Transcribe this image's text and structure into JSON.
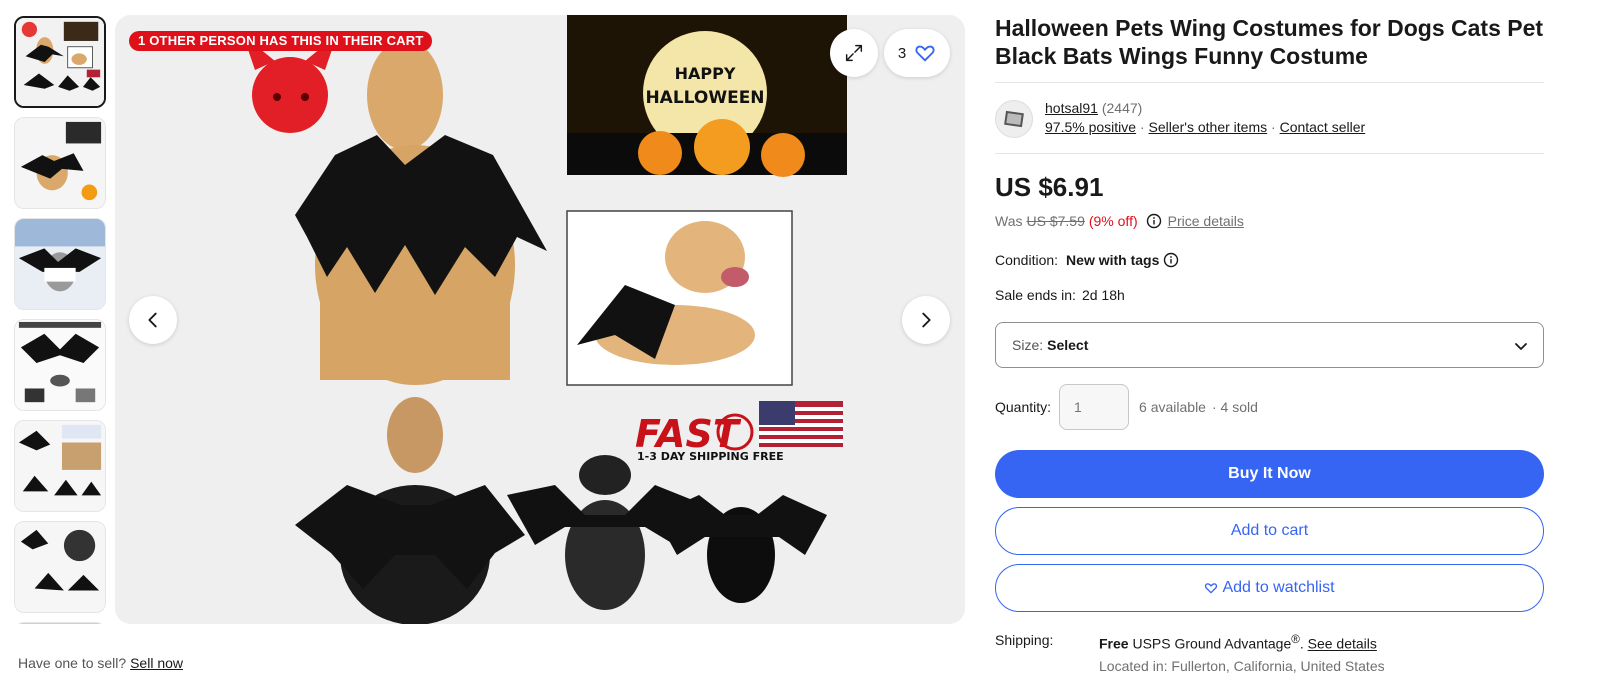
{
  "gallery": {
    "cart_badge": "1 OTHER PERSON HAS THIS IN THEIR CART",
    "watch_count": "3",
    "thumbnails": [
      {
        "name": "thumbnail-1",
        "active": true
      },
      {
        "name": "thumbnail-2",
        "active": false
      },
      {
        "name": "thumbnail-3",
        "active": false
      },
      {
        "name": "thumbnail-4",
        "active": false
      },
      {
        "name": "thumbnail-5",
        "active": false
      },
      {
        "name": "thumbnail-6",
        "active": false
      },
      {
        "name": "thumbnail-7",
        "active": false
      }
    ],
    "image_text": {
      "happy": "HAPPY",
      "halloween": "HALLOWEEN",
      "fast": "FAST",
      "shipping": "1-3 DAY SHIPPING FREE"
    }
  },
  "sell": {
    "prompt": "Have one to sell?",
    "link": "Sell now"
  },
  "product": {
    "title": "Halloween Pets Wing Costumes for Dogs Cats Pet Black Bats Wings Funny Costume",
    "seller": {
      "name": "hotsal91",
      "feedback_count": "(2447)",
      "positive": "97.5% positive",
      "other_items": "Seller's other items",
      "contact": "Contact seller"
    },
    "price": "US $6.91",
    "was_label": "Was",
    "was_price": "US $7.59",
    "discount": "(9% off)",
    "price_details": "Price details",
    "condition_label": "Condition:",
    "condition_value": "New with tags",
    "sale_label": "Sale ends in:",
    "sale_value": "2d 18h",
    "size_label": "Size:",
    "size_value": "Select",
    "quantity_label": "Quantity:",
    "quantity_placeholder": "1",
    "available": "6 available",
    "sold": "· 4 sold",
    "buy_now": "Buy It Now",
    "add_to_cart": "Add to cart",
    "add_to_watchlist": "Add to watchlist",
    "shipping_label": "Shipping:",
    "shipping_free": "Free",
    "shipping_method": "USPS Ground Advantage",
    "shipping_reg": "®",
    "shipping_see": "See details",
    "shipping_location": "Located in: Fullerton, California, United States"
  },
  "colors": {
    "accent_blue": "#3665f3",
    "badge_red": "#e0101a",
    "text": "#191919",
    "muted": "#707070"
  },
  "icons": {
    "expand": "expand-icon",
    "heart": "heart-icon",
    "prev": "chevron-left-icon",
    "next": "chevron-right-icon",
    "info": "info-icon",
    "dropdown": "chevron-down-icon"
  }
}
